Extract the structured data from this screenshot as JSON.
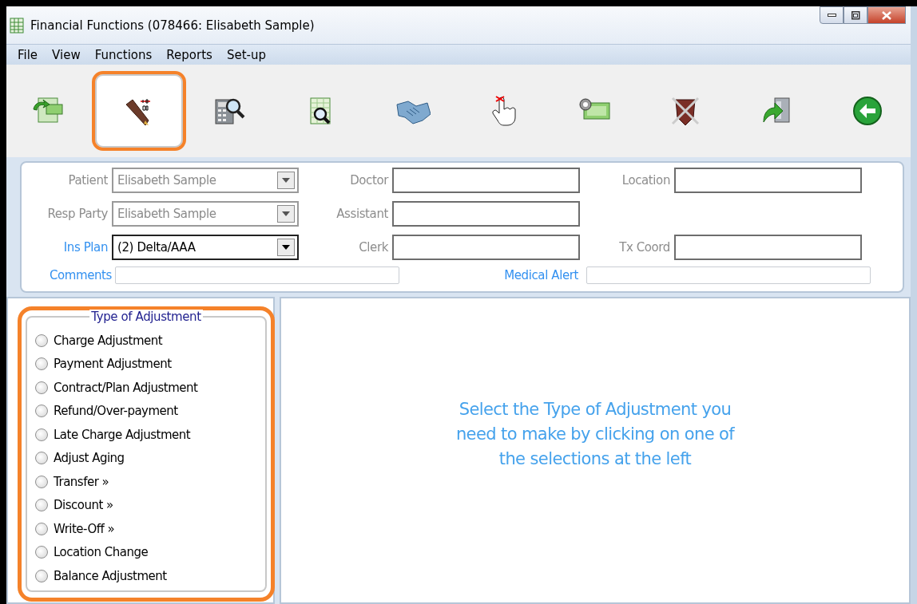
{
  "window": {
    "title": "Financial Functions (078466: Elisabeth Sample)"
  },
  "menu": [
    "File",
    "View",
    "Functions",
    "Reports",
    "Set-up"
  ],
  "toolbar": [
    {
      "selected": false
    },
    {
      "selected": true
    },
    {
      "selected": false
    },
    {
      "selected": false
    },
    {
      "selected": false
    },
    {
      "selected": false
    },
    {
      "selected": false
    },
    {
      "selected": false
    },
    {
      "selected": false
    },
    {
      "selected": false
    }
  ],
  "form": {
    "fields": [
      {
        "label": "Patient",
        "kind": "combo",
        "value": "Elisabeth Sample",
        "disabled": true,
        "link": false
      },
      {
        "label": "Doctor",
        "kind": "text",
        "disabled": false,
        "link": false
      },
      {
        "label": "Location",
        "kind": "text",
        "disabled": false,
        "link": false
      },
      {
        "label": "Resp Party",
        "kind": "combo",
        "value": "Elisabeth Sample",
        "disabled": true,
        "link": false
      },
      {
        "label": "Assistant",
        "kind": "text",
        "disabled": false,
        "link": false
      },
      {
        "kind": "blank"
      },
      {
        "label": "Ins Plan",
        "kind": "combo",
        "value": "(2) Delta/AAA",
        "disabled": false,
        "link": true
      },
      {
        "label": "Clerk",
        "kind": "text",
        "disabled": false,
        "link": false
      },
      {
        "label": "Tx Coord",
        "kind": "text",
        "disabled": false,
        "link": false
      }
    ],
    "notes": [
      {
        "label": "Comments",
        "link": true
      },
      {
        "label": "Medical Alert",
        "link": true
      }
    ]
  },
  "adjustment": {
    "title": "Type of Adjustment",
    "highlighted": true,
    "options": [
      {
        "label": "Charge Adjustment",
        "selected": false
      },
      {
        "label": "Payment Adjustment",
        "selected": false
      },
      {
        "label": "Contract/Plan Adjustment",
        "selected": false
      },
      {
        "label": "Refund/Over-payment",
        "selected": false
      },
      {
        "label": "Late Charge Adjustment",
        "selected": false
      },
      {
        "label": "Adjust Aging",
        "selected": false
      },
      {
        "label": "Transfer »",
        "selected": false
      },
      {
        "label": "Discount »",
        "selected": false
      },
      {
        "label": "Write-Off »",
        "selected": false
      },
      {
        "label": "Location Change",
        "selected": false
      },
      {
        "label": "Balance Adjustment",
        "selected": false
      }
    ]
  },
  "message": "Select the Type of Adjustment you need to make by clicking on one of the selections at the left"
}
